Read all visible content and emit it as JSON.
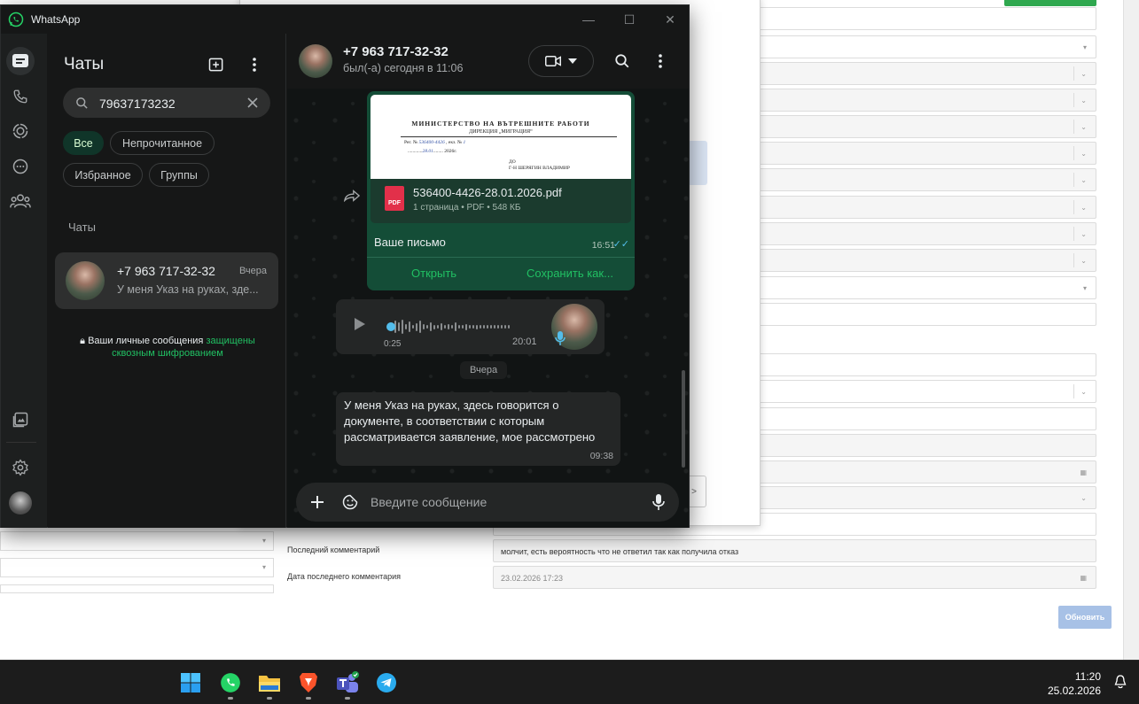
{
  "crm": {
    "last_comment_label": "Последний комментарий",
    "last_comment_value": "молчит, есть вероятность что не ответил так как получила отказ",
    "last_comment_date_label": "Дата последнего комментария",
    "last_comment_date_value": "23.02.2026 17:23",
    "update_button": "Обновить"
  },
  "whatsapp": {
    "window_title": "WhatsApp",
    "sidebar": {
      "title": "Чаты",
      "search_value": "79637173232",
      "filters": [
        "Все",
        "Непрочитанное",
        "Избранное",
        "Группы"
      ],
      "section_label": "Чаты",
      "chat": {
        "name": "+7 963 717-32-32",
        "time": "Вчера",
        "preview": "У меня Указ на руках, зде..."
      },
      "encryption_note_a": "Ваши личные сообщения",
      "encryption_note_b": "защищены сквозным шифрованием"
    },
    "conversation": {
      "contact_name": "+7 963 717-32-32",
      "contact_status": "был(-а) сегодня в 11:06",
      "document": {
        "thumb_line1": "МИНИСТЕРСТВО НА ВЪТРЕШНИТЕ РАБОТИ",
        "thumb_line2": "ДИРЕКЦИЯ „МИГРАЦИЯ“",
        "thumb_reg_prefix": "Рег. №",
        "thumb_reg_hand": "536400-4426",
        "thumb_reg_suffix": ", екз. №",
        "thumb_reg_copy": "1",
        "thumb_date_hand": "28.01",
        "thumb_date_suffix": "2026г.",
        "thumb_to": "ДО",
        "thumb_recipient": "Г-Н ШЕРЯГИН ВЛАДИМИР",
        "file_name": "536400-4426-28.01.2026.pdf",
        "file_meta": "1 страница • PDF • 548 КБ",
        "file_type": "PDF",
        "caption": "Ваше письмо",
        "time": "16:51",
        "open_action": "Открыть",
        "save_action": "Сохранить как..."
      },
      "voice": {
        "duration": "0:25",
        "time": "20:01"
      },
      "date_separator": "Вчера",
      "incoming": {
        "text": "У меня Указ на руках, здесь говорится о документе, в соответствии с которым рассматривается заявление, мое рассмотрено",
        "time": "09:38"
      },
      "composer_placeholder": "Введите сообщение"
    }
  },
  "taskbar": {
    "time": "11:20",
    "date": "25.02.2026"
  },
  "colors": {
    "wa_green": "#21c063",
    "wa_bg": "#161717",
    "outgoing_bubble": "#144d37",
    "incoming_bubble": "#242626",
    "read_ticks": "#53bdeb",
    "pdf_red": "#e2304a"
  },
  "icons": [
    "whatsapp-icon",
    "chats-icon",
    "calls-icon",
    "status-icon",
    "channels-icon",
    "communities-icon",
    "media-icon",
    "settings-icon",
    "new-chat-icon",
    "menu-icon",
    "search-icon",
    "clear-icon",
    "lock-icon",
    "video-call-icon",
    "forward-icon",
    "play-icon",
    "mic-icon",
    "plus-icon",
    "sticker-icon",
    "windows-start-icon",
    "file-explorer-icon",
    "brave-icon",
    "teams-icon",
    "telegram-icon",
    "notification-bell-icon"
  ]
}
